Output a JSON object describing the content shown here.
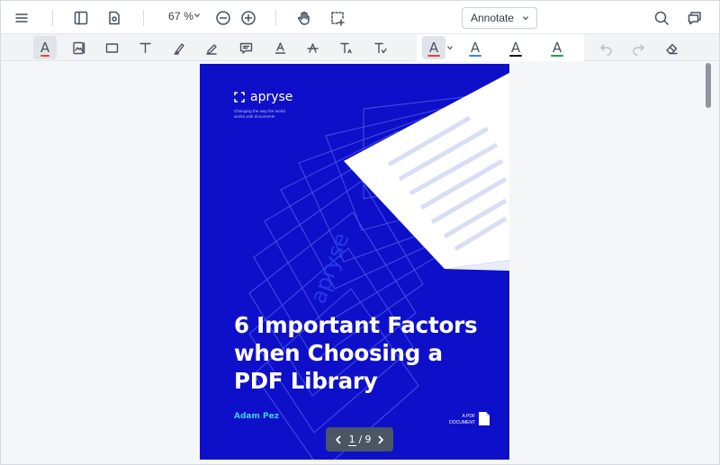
{
  "header": {
    "menu_icon": "hamburger-menu-icon",
    "zoom": {
      "value": "67",
      "unit": "%"
    },
    "mode": {
      "selected": "Annotate"
    }
  },
  "toolbar": {
    "tools": [
      "text-color-icon",
      "image-annotation-icon",
      "rectangle-icon",
      "free-text-icon",
      "highlighter-icon",
      "free-hand-pen-icon",
      "comment-icon",
      "underline-text-icon",
      "strikeout-text-icon",
      "insert-text-icon",
      "replace-text-icon"
    ],
    "color_presets": [
      "#e0443a",
      "#3b82f6",
      "#111111",
      "#16a34a"
    ],
    "undo_disabled": true,
    "redo_disabled": true
  },
  "document": {
    "brand": "apryse",
    "tagline": "Changing the way the world works with documents",
    "watermark": "apryse",
    "title_lines": [
      "6 Important Factors",
      "when Choosing a",
      "PDF Library"
    ],
    "author": "Adam Pez",
    "badge_lines": [
      "A PDF",
      "DOCUMENT"
    ],
    "background": "#0e10c9",
    "accent": "#3fd0e8"
  },
  "pagination": {
    "current": "1",
    "separator": "/",
    "total": "9"
  }
}
